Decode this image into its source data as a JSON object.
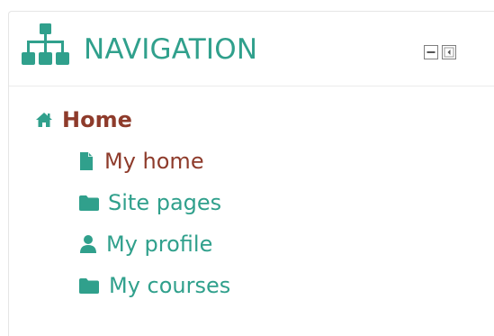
{
  "block": {
    "title": "NAVIGATION",
    "icon": "sitemap-icon",
    "controls": [
      {
        "name": "dock-collapse",
        "icon": "minus-square-icon"
      },
      {
        "name": "dock-to-side",
        "icon": "dock-left-icon"
      }
    ]
  },
  "nav": {
    "home": {
      "label": "Home",
      "icon": "home-icon"
    },
    "items": [
      {
        "label": "My home",
        "icon": "file-icon"
      },
      {
        "label": "Site pages",
        "icon": "folder-icon"
      },
      {
        "label": "My profile",
        "icon": "user-icon"
      },
      {
        "label": "My courses",
        "icon": "folder-icon"
      }
    ]
  },
  "colors": {
    "accent": "#30a08c",
    "active": "#8e3b2b",
    "border": "#e5e5e5"
  }
}
